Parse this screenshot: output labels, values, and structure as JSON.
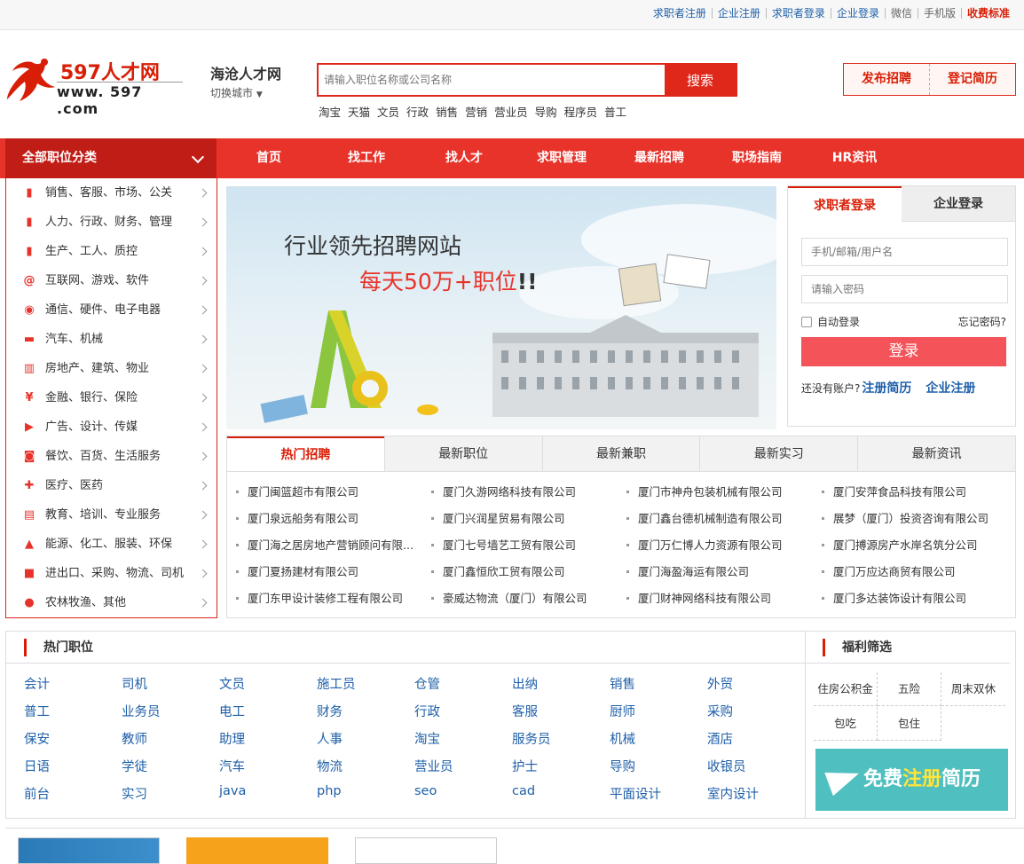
{
  "top": {
    "links": [
      "求职者注册",
      "企业注册",
      "求职者登录",
      "企业登录",
      "微信",
      "手机版",
      "收费标准"
    ]
  },
  "header": {
    "logo_name": "597人才网",
    "logo_url": "www. 597 .com",
    "city_name": "海沧人才网",
    "city_switch": "切换城市",
    "search_placeholder": "请输入职位名称或公司名称",
    "search_button": "搜索",
    "hot_words": [
      "淘宝",
      "天猫",
      "文员",
      "行政",
      "销售",
      "营销",
      "营业员",
      "导购",
      "程序员",
      "普工"
    ],
    "post_job": "发布招聘",
    "post_resume": "登记简历"
  },
  "nav": {
    "all_categories": "全部职位分类",
    "items": [
      "首页",
      "找工作",
      "找人才",
      "求职管理",
      "最新招聘",
      "职场指南",
      "HR资讯"
    ]
  },
  "categories": [
    {
      "label": "销售、客服、市场、公关",
      "icon": "bookmark-icon"
    },
    {
      "label": "人力、行政、财务、管理",
      "icon": "bookmark-icon"
    },
    {
      "label": "生产、工人、质控",
      "icon": "bookmark-icon"
    },
    {
      "label": "互联网、游戏、软件",
      "icon": "internet-icon"
    },
    {
      "label": "通信、硬件、电子电器",
      "icon": "router-icon"
    },
    {
      "label": "汽车、机械",
      "icon": "car-icon"
    },
    {
      "label": "房地产、建筑、物业",
      "icon": "building-icon"
    },
    {
      "label": "金融、银行、保险",
      "icon": "yen-icon"
    },
    {
      "label": "广告、设计、传媒",
      "icon": "video-icon"
    },
    {
      "label": "餐饮、百货、生活服务",
      "icon": "shopping-bag-icon"
    },
    {
      "label": "医疗、医药",
      "icon": "medical-icon"
    },
    {
      "label": "教育、培训、专业服务",
      "icon": "book-icon"
    },
    {
      "label": "能源、化工、服装、环保",
      "icon": "flask-icon"
    },
    {
      "label": "进出口、采购、物流、司机",
      "icon": "truck-icon"
    },
    {
      "label": "农林牧渔、其他",
      "icon": "globe-icon"
    }
  ],
  "banner": {
    "line1": "行业领先招聘网站",
    "line2_a": "每天50万+职位",
    "line2_b": "!!"
  },
  "login": {
    "tab_seeker": "求职者登录",
    "tab_company": "企业登录",
    "user_placeholder": "手机/邮箱/用户名",
    "pwd_placeholder": "请输入密码",
    "auto_login": "自动登录",
    "forgot": "忘记密码?",
    "submit": "登录",
    "no_account": "还没有账户?",
    "reg_resume": "注册简历",
    "reg_company": "企业注册"
  },
  "hot_tabs": [
    "热门招聘",
    "最新职位",
    "最新兼职",
    "最新实习",
    "最新资讯"
  ],
  "companies": [
    [
      "厦门闽篮超市有限公司",
      "厦门久游网络科技有限公司",
      "厦门市神舟包装机械有限公司",
      "厦门安萍食品科技有限公司"
    ],
    [
      "厦门泉远船务有限公司",
      "厦门兴润星贸易有限公司",
      "厦门鑫台德机械制造有限公司",
      "展梦（厦门）投资咨询有限公司"
    ],
    [
      "厦门海之居房地产营销顾问有限...",
      "厦门七号墙艺工贸有限公司",
      "厦门万仁博人力资源有限公司",
      "厦门搏源房产水岸名筑分公司"
    ],
    [
      "厦门夏扬建材有限公司",
      "厦门鑫恒欣工贸有限公司",
      "厦门海盈海运有限公司",
      "厦门万应达商贸有限公司"
    ],
    [
      "厦门东甲设计装修工程有限公司",
      "豪威达物流（厦门）有限公司",
      "厦门财神网络科技有限公司",
      "厦门多达装饰设计有限公司"
    ]
  ],
  "hot_jobs": {
    "title": "热门职位",
    "items": [
      [
        "会计",
        "司机",
        "文员",
        "施工员",
        "仓管",
        "出纳",
        "销售",
        "外贸"
      ],
      [
        "普工",
        "业务员",
        "电工",
        "财务",
        "行政",
        "客服",
        "厨师",
        "采购"
      ],
      [
        "保安",
        "教师",
        "助理",
        "人事",
        "淘宝",
        "服务员",
        "机械",
        "酒店"
      ],
      [
        "日语",
        "学徒",
        "汽车",
        "物流",
        "营业员",
        "护士",
        "导购",
        "收银员"
      ],
      [
        "前台",
        "实习",
        "java",
        "php",
        "seo",
        "cad",
        "平面设计",
        "室内设计"
      ]
    ]
  },
  "welfare": {
    "title": "福利筛选",
    "items": [
      "住房公积金",
      "五险",
      "周末双休",
      "包吃",
      "包住"
    ],
    "free_reg_a": "免费",
    "free_reg_b": "注册",
    "free_reg_c": "简历"
  },
  "colors": {
    "brand_red": "#e8332a",
    "link_blue": "#1e5fa8",
    "teal": "#4fbfbf"
  }
}
